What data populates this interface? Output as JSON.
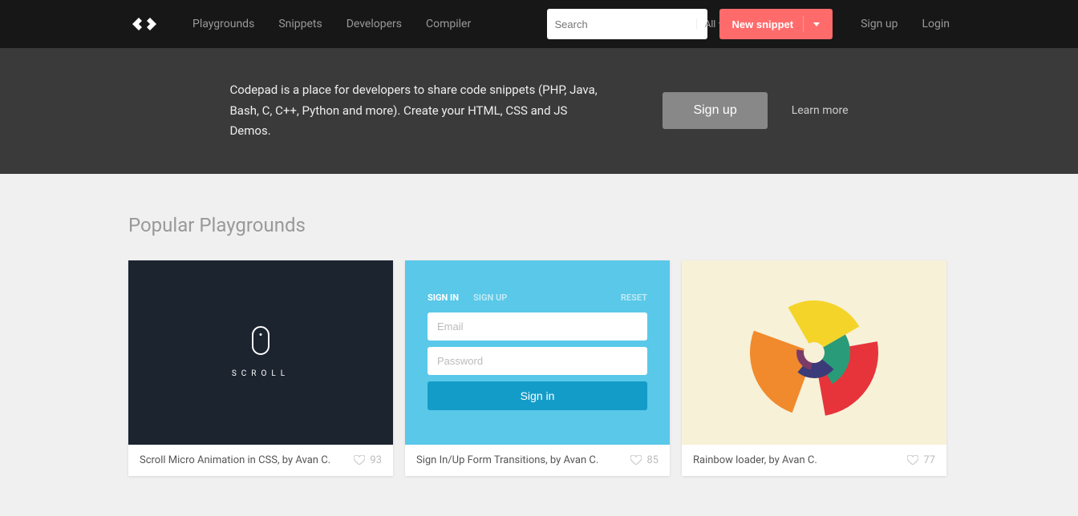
{
  "nav": {
    "links": [
      "Playgrounds",
      "Snippets",
      "Developers",
      "Compiler"
    ],
    "search_placeholder": "Search",
    "search_filter": "All",
    "new_snippet": "New snippet",
    "signup": "Sign up",
    "login": "Login"
  },
  "hero": {
    "text": "Codepad is a place for developers to share code snippets (PHP, Java, Bash, C, C++, Python and more). Create your HTML, CSS and JS Demos.",
    "signup": "Sign up",
    "learnmore": "Learn more"
  },
  "section": {
    "title": "Popular Playgrounds"
  },
  "cards": [
    {
      "title": "Scroll Micro Animation in CSS, by Avan C.",
      "likes": "93",
      "scroll_label": "Scroll"
    },
    {
      "title": "Sign In/Up Form Transitions, by Avan C.",
      "likes": "85",
      "tab_signin": "SIGN IN",
      "tab_signup": "SIGN UP",
      "tab_reset": "RESET",
      "ph_email": "Email",
      "ph_password": "Password",
      "btn_signin": "Sign in"
    },
    {
      "title": "Rainbow loader, by Avan C.",
      "likes": "77"
    }
  ]
}
